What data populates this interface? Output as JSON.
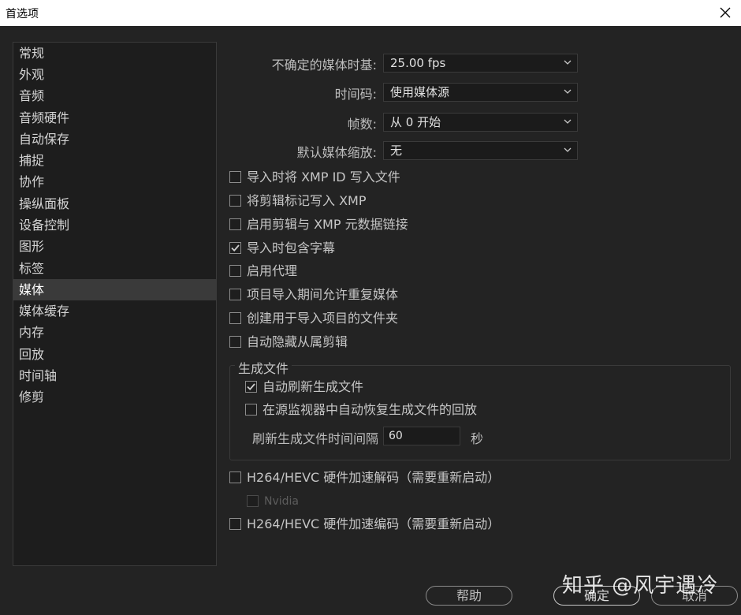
{
  "window": {
    "title": "首选项"
  },
  "sidebar": {
    "items": [
      {
        "label": "常规"
      },
      {
        "label": "外观"
      },
      {
        "label": "音频"
      },
      {
        "label": "音频硬件"
      },
      {
        "label": "自动保存"
      },
      {
        "label": "捕捉"
      },
      {
        "label": "协作"
      },
      {
        "label": "操纵面板"
      },
      {
        "label": "设备控制"
      },
      {
        "label": "图形"
      },
      {
        "label": "标签"
      },
      {
        "label": "媒体",
        "selected": true
      },
      {
        "label": "媒体缓存"
      },
      {
        "label": "内存"
      },
      {
        "label": "回放"
      },
      {
        "label": "时间轴"
      },
      {
        "label": "修剪"
      }
    ]
  },
  "media": {
    "timebase": {
      "label": "不确定的媒体时基:",
      "value": "25.00 fps"
    },
    "timecode": {
      "label": "时间码:",
      "value": "使用媒体源"
    },
    "frame_count": {
      "label": "帧数:",
      "value": "从 0 开始"
    },
    "default_scaling": {
      "label": "默认媒体缩放:",
      "value": "无"
    },
    "checkboxes": [
      {
        "label": "导入时将 XMP ID 写入文件",
        "checked": false
      },
      {
        "label": "将剪辑标记写入 XMP",
        "checked": false
      },
      {
        "label": "启用剪辑与 XMP 元数据链接",
        "checked": false
      },
      {
        "label": "导入时包含字幕",
        "checked": true
      },
      {
        "label": "启用代理",
        "checked": false
      },
      {
        "label": "项目导入期间允许重复媒体",
        "checked": false
      },
      {
        "label": "创建用于导入项目的文件夹",
        "checked": false
      },
      {
        "label": "自动隐藏从属剪辑",
        "checked": false
      }
    ],
    "growing_files": {
      "title": "生成文件",
      "auto_refresh": {
        "label": "自动刷新生成文件",
        "checked": true
      },
      "restore_playback": {
        "label": "在源监视器中自动恢复生成文件的回放",
        "checked": false
      },
      "refresh_interval": {
        "label": "刷新生成文件时间间隔",
        "value": "60",
        "unit": "秒"
      }
    },
    "hw_decode": {
      "label": "H264/HEVC 硬件加速解码（需要重新启动）",
      "checked": false
    },
    "nvidia": {
      "label": "Nvidia",
      "checked": false,
      "disabled": true
    },
    "hw_encode": {
      "label": "H264/HEVC 硬件加速编码（需要重新启动）",
      "checked": false
    }
  },
  "buttons": {
    "help": "帮助",
    "ok": "确定",
    "cancel": "取消"
  },
  "watermark": "知乎 @风宇遇冷",
  "colors": {
    "background": "#232323",
    "panel": "#1d1d1d",
    "selected": "#3a3a3a"
  }
}
